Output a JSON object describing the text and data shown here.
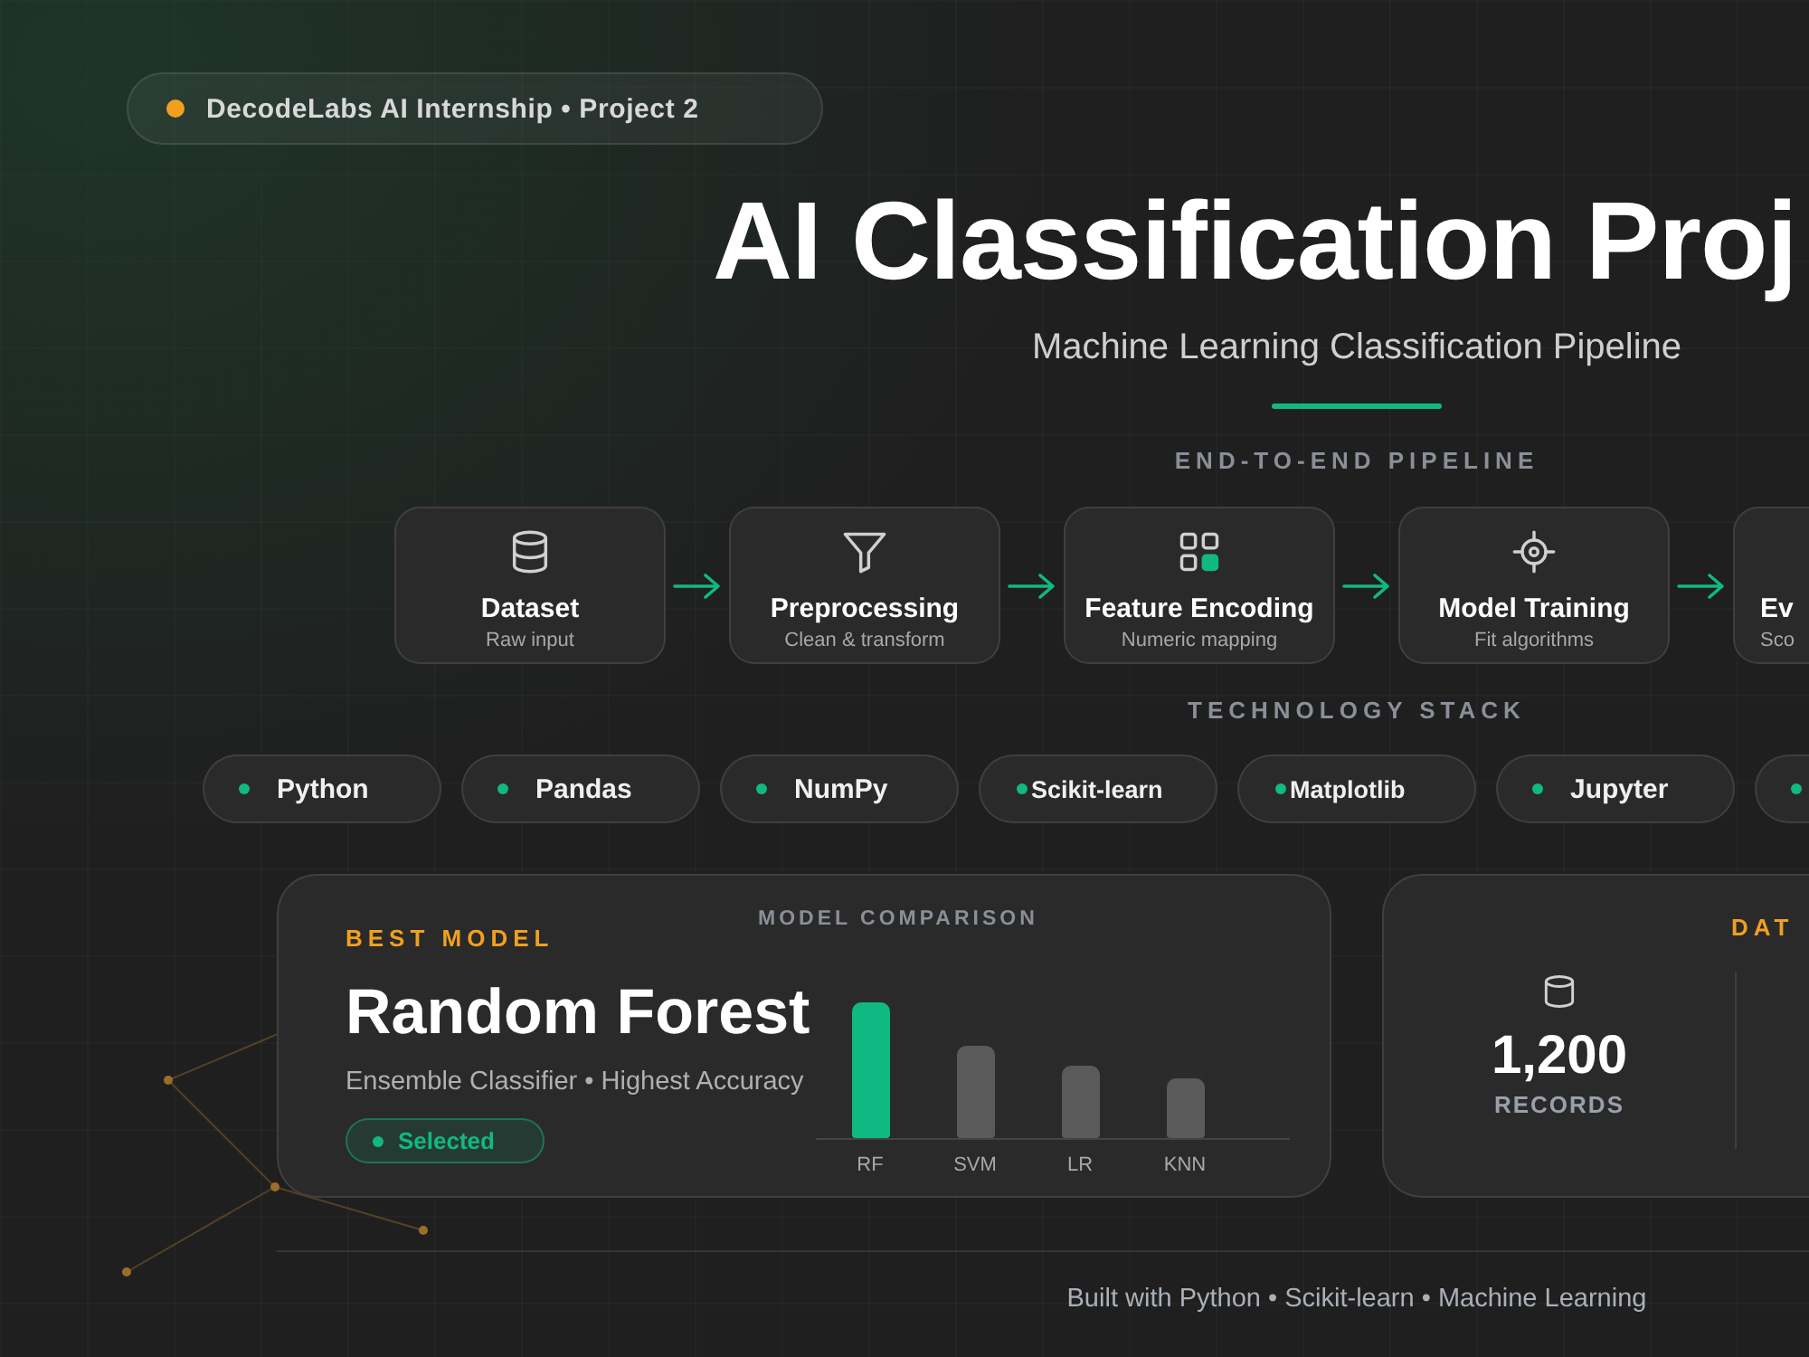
{
  "badge": {
    "label": "DecodeLabs AI Internship • Project 2"
  },
  "hero": {
    "title": "AI Classification Proj",
    "subtitle": "Machine Learning Classification Pipeline"
  },
  "pipeline": {
    "heading": "END-TO-END PIPELINE",
    "steps": [
      {
        "kind": "database",
        "title": "Dataset",
        "caption": "Raw input"
      },
      {
        "kind": "filter",
        "title": "Preprocessing",
        "caption": "Clean & transform"
      },
      {
        "kind": "grid",
        "title": "Feature Encoding",
        "caption": "Numeric mapping"
      },
      {
        "kind": "target",
        "title": "Model Training",
        "caption": "Fit algorithms"
      },
      {
        "kind": "cut",
        "title": "Ev",
        "caption": "Sco"
      }
    ]
  },
  "tech_stack": {
    "heading": "TECHNOLOGY STACK",
    "items": [
      {
        "kind": "chip",
        "label": "Python"
      },
      {
        "kind": "chip",
        "label": "Pandas"
      },
      {
        "kind": "chip",
        "label": "NumPy"
      },
      {
        "kind": "chip",
        "label": "Scikit-learn"
      },
      {
        "kind": "chip",
        "label": "Matplotlib"
      },
      {
        "kind": "chip",
        "label": "Jupyter"
      },
      {
        "kind": "cut"
      }
    ]
  },
  "best_model": {
    "heading": "BEST MODEL",
    "name": "Random Forest",
    "description": "Ensemble Classifier • Highest Accuracy",
    "status": "Selected"
  },
  "model_comparison": {
    "title": "MODEL COMPARISON",
    "bars": [
      {
        "label": "RF",
        "selected": true,
        "level": 0.94
      },
      {
        "label": "SVM",
        "selected": false,
        "level": 0.64
      },
      {
        "label": "LR",
        "selected": false,
        "level": 0.5
      },
      {
        "label": "KNN",
        "selected": false,
        "level": 0.41
      }
    ]
  },
  "dataset": {
    "heading": "DAT",
    "stats": [
      {
        "value": "1,200",
        "label": "RECORDS"
      }
    ]
  },
  "footer": "Built with Python • Scikit-learn • Machine Learning"
}
